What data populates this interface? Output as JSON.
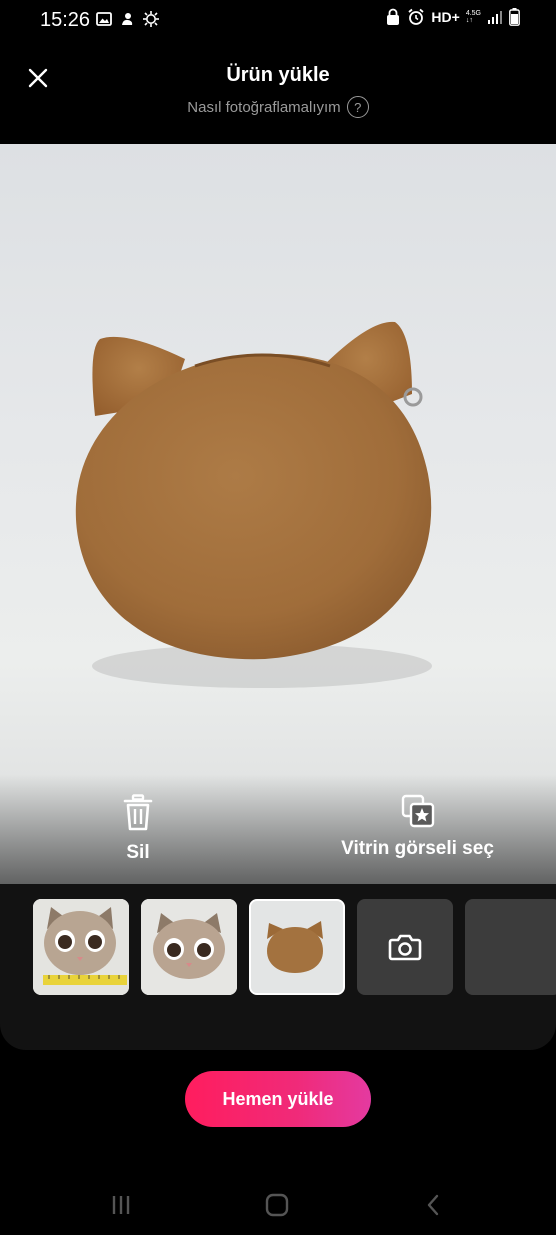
{
  "status_bar": {
    "time": "15:26",
    "network": "HD+",
    "network_sup_top": "4.5G",
    "network_sup_bottom": "↓↑"
  },
  "header": {
    "title": "Ürün yükle",
    "help_link": "Nasıl fotoğraflamalıyım",
    "help_icon_glyph": "?"
  },
  "photo_actions": {
    "delete_label": "Sil",
    "showcase_label": "Vitrin görseli seç"
  },
  "thumbnails": [
    {
      "kind": "photo",
      "desc_icon": "cat-face-with-ruler"
    },
    {
      "kind": "photo",
      "desc_icon": "cat-face"
    },
    {
      "kind": "photo",
      "selected": true,
      "desc_icon": "brown-cat-purse"
    },
    {
      "kind": "camera",
      "desc_icon": "camera-icon"
    },
    {
      "kind": "empty"
    }
  ],
  "primary_action": {
    "label": "Hemen yükle"
  },
  "colors": {
    "accent_start": "#ff1d5e",
    "accent_end": "#e43aa0",
    "purse_brown": "#a3723f"
  }
}
